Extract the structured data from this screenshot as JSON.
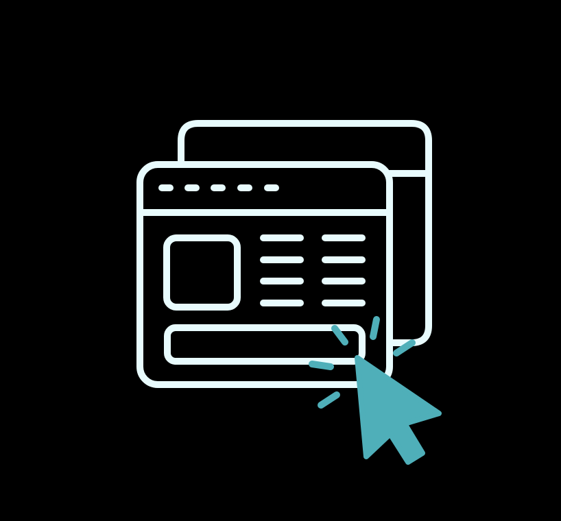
{
  "illustration": {
    "subject": "browser-windows-with-cursor-click",
    "colors": {
      "background": "#000000",
      "outline": "#e8fbfd",
      "accent": "#4fafb9"
    },
    "icons": {
      "back_window": "browser-window-icon",
      "front_window": "browser-window-icon",
      "cursor": "cursor-arrow-icon",
      "click_burst": "click-burst-icon"
    }
  }
}
